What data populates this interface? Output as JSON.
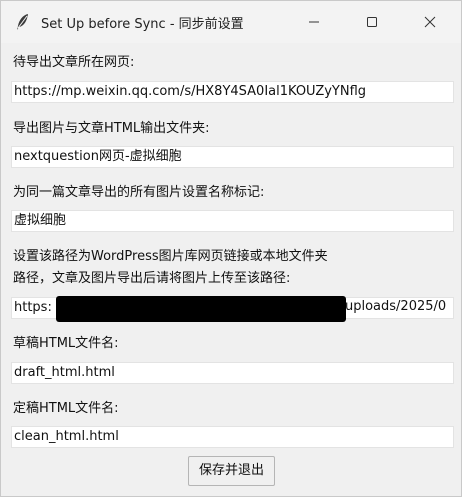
{
  "window": {
    "title": "Set Up before Sync - 同步前设置"
  },
  "titlebar": {
    "app_icon": "feather-icon",
    "minimize_icon": "minimize-icon",
    "maximize_icon": "maximize-icon",
    "close_icon": "close-icon"
  },
  "form": {
    "url_label": "待导出文章所在网页:",
    "url_value": "https://mp.weixin.qq.com/s/HX8Y4SA0Ial1KOUZyYNflg",
    "folder_label": "导出图片与文章HTML输出文件夹:",
    "folder_value": "nextquestion网页-虚拟细胞",
    "image_tag_label": "为同一篇文章导出的所有图片设置名称标记:",
    "image_tag_value": "虚拟细胞",
    "path_label_line1": "设置该路径为WordPress图片库网页链接或本地文件夹",
    "path_label_line2": "路径，文章及图片导出后请将图片上传至该路径:",
    "path_value_start": "https:",
    "path_value_end": "uploads/2025/0",
    "draft_label": "草稿HTML文件名:",
    "draft_value": "draft_html.html",
    "clean_label": "定稿HTML文件名:",
    "clean_value": "clean_html.html"
  },
  "actions": {
    "save_exit_label": "保存并退出"
  }
}
